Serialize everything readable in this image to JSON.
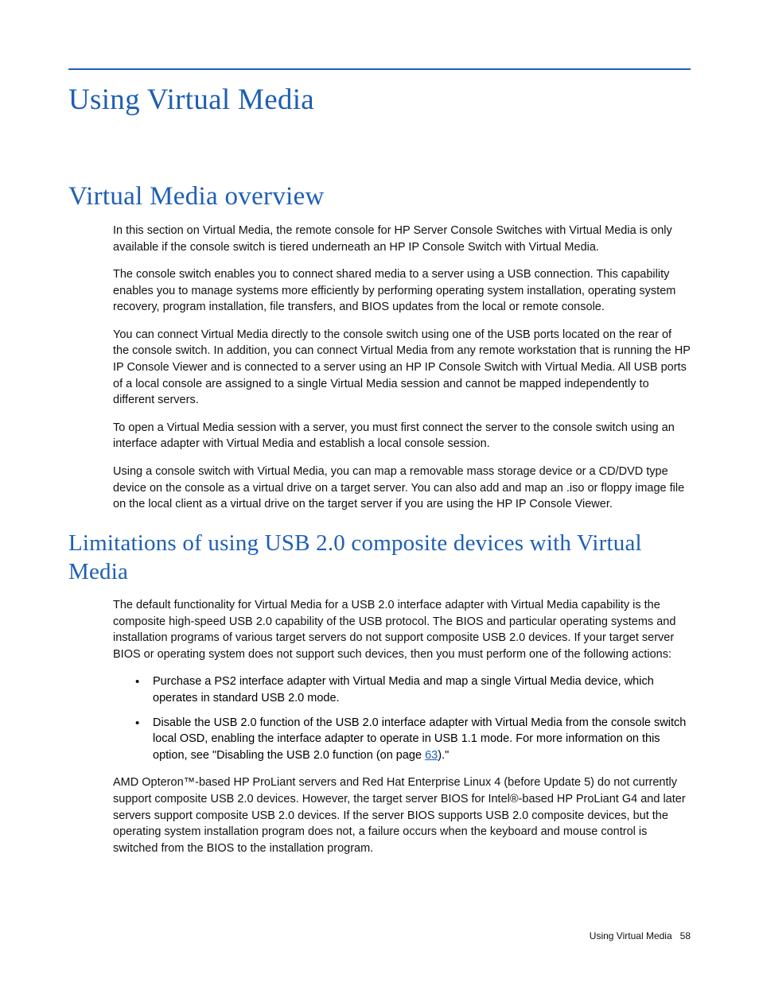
{
  "headings": {
    "h1": "Using Virtual Media",
    "h2": "Virtual Media overview",
    "h3": "Limitations of using USB 2.0 composite devices with Virtual Media"
  },
  "overview": {
    "p1": "In this section on Virtual Media, the remote console for HP Server Console Switches with Virtual Media is only available if the console switch is tiered underneath an HP IP Console Switch with Virtual Media.",
    "p2": "The console switch enables you to connect shared media to a server using a USB connection. This capability enables you to manage systems more efficiently by performing operating system installation, operating system recovery, program installation, file transfers, and BIOS updates from the local or remote console.",
    "p3": "You can connect Virtual Media directly to the console switch using one of the USB ports located on the rear of the console switch. In addition, you can connect Virtual Media from any remote workstation that is running the HP IP Console Viewer and is connected to a server using an HP IP Console Switch with Virtual Media. All USB ports of a local console are assigned to a single Virtual Media session and cannot be mapped independently to different servers.",
    "p4": "To open a Virtual Media session with a server, you must first connect the server to the console switch using an interface adapter with Virtual Media and establish a local console session.",
    "p5": "Using a console switch with Virtual Media, you can map a removable mass storage device or a CD/DVD type device on the console as a virtual drive on a target server. You can also add and map an .iso or floppy image file on the local client as a virtual drive on the target server if you are using the HP IP Console Viewer."
  },
  "limitations": {
    "intro": "The default functionality for Virtual Media for a USB 2.0 interface adapter with Virtual Media capability is the composite high-speed USB 2.0 capability of the USB protocol. The BIOS and particular operating systems and installation programs of various target servers do not support composite USB 2.0 devices. If your target server BIOS or operating system does not support such devices, then you must perform one of the following actions:",
    "bullets": {
      "b1": "Purchase a PS2 interface adapter with Virtual Media and map a single Virtual Media device, which operates in standard USB 2.0 mode.",
      "b2_pre": "Disable the USB 2.0 function of the USB 2.0 interface adapter with Virtual Media from the console switch local OSD, enabling the interface adapter to operate in USB 1.1 mode. For more information on this option, see \"Disabling the USB 2.0 function (on page ",
      "b2_link": "63",
      "b2_post": ").\""
    },
    "after": "AMD Opteron™-based HP ProLiant servers and Red Hat Enterprise Linux 4 (before Update 5) do not currently support composite USB 2.0 devices. However, the target server BIOS for Intel®-based HP ProLiant G4 and later servers support composite USB 2.0 devices. If the server BIOS supports USB 2.0 composite devices, but the operating system installation program does not, a failure occurs when the keyboard and mouse control is switched from the BIOS to the installation program."
  },
  "footer": {
    "section": "Using Virtual Media",
    "page": "58"
  }
}
